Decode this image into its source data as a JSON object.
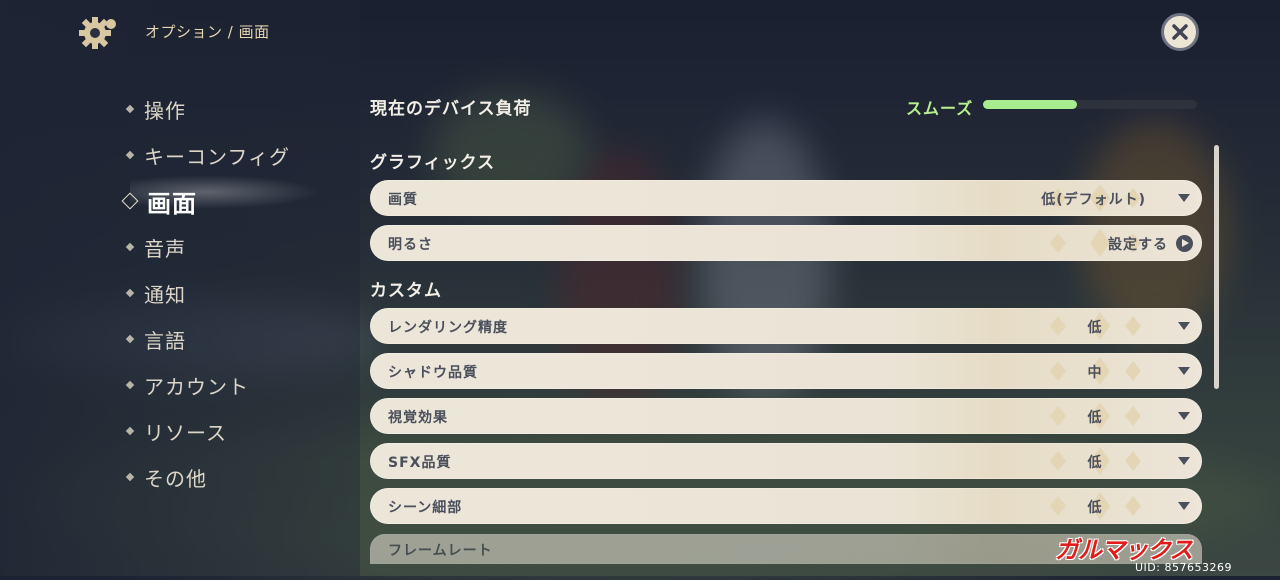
{
  "header": {
    "breadcrumb": "オプション / 画面",
    "settings_icon": "gear-icon",
    "close_icon": "close-icon"
  },
  "sidebar": {
    "items": [
      {
        "label": "操作",
        "active": false
      },
      {
        "label": "キーコンフィグ",
        "active": false
      },
      {
        "label": "画面",
        "active": true
      },
      {
        "label": "音声",
        "active": false
      },
      {
        "label": "通知",
        "active": false
      },
      {
        "label": "言語",
        "active": false
      },
      {
        "label": "アカウント",
        "active": false
      },
      {
        "label": "リソース",
        "active": false
      },
      {
        "label": "その他",
        "active": false
      }
    ]
  },
  "device_load": {
    "title": "現在のデバイス負荷",
    "status": "スムーズ",
    "level_percent": 44,
    "color": "#a7ec8e"
  },
  "graphics": {
    "title": "グラフィックス",
    "rows": [
      {
        "label": "画質",
        "value": "低(デフォルト)",
        "control": "dropdown"
      },
      {
        "label": "明るさ",
        "value": "設定する",
        "control": "play"
      }
    ]
  },
  "custom": {
    "title": "カスタム",
    "rows": [
      {
        "label": "レンダリング精度",
        "value": "低",
        "control": "dropdown"
      },
      {
        "label": "シャドウ品質",
        "value": "中",
        "control": "dropdown"
      },
      {
        "label": "視覚効果",
        "value": "低",
        "control": "dropdown"
      },
      {
        "label": "SFX品質",
        "value": "低",
        "control": "dropdown"
      },
      {
        "label": "シーン細部",
        "value": "低",
        "control": "dropdown"
      },
      {
        "label": "フレームレート",
        "value": "",
        "control": "dropdown"
      }
    ]
  },
  "watermark": "ガルマックス",
  "uid": "UID: 857653269",
  "colors": {
    "accent_gold": "#e6d7b0",
    "row_bg": "#ece6d9",
    "row_text": "#4a4f5c",
    "load_green": "#a7ec8e"
  }
}
